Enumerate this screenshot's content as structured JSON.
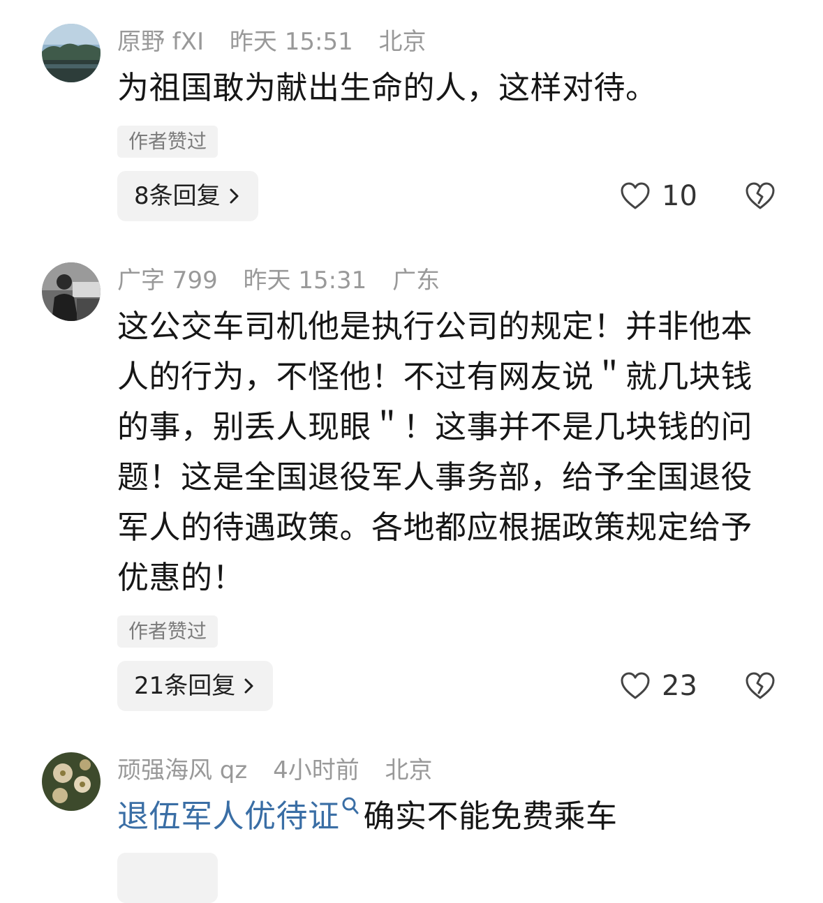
{
  "comments": [
    {
      "username": "原野 fXI",
      "time": "昨天 15:51",
      "location": "北京",
      "text": "为祖国敢为献出生命的人，这样对待。",
      "badge": "作者赞过",
      "replies_label": "8条回复",
      "likes": "10",
      "avatar_icon": "landscape-lake-avatar"
    },
    {
      "username": "广字 799",
      "time": "昨天 15:31",
      "location": "广东",
      "text": "这公交车司机他是执行公司的规定！并非他本人的行为，不怪他！不过有网友说＂就几块钱的事，别丢人现眼＂！这事并不是几块钱的问题！这是全国退役军人事务部，给予全国退役军人的待遇政策。各地都应根据政策规定给予优惠的！",
      "badge": "作者赞过",
      "replies_label": "21条回复",
      "likes": "23",
      "avatar_icon": "person-photo-avatar"
    },
    {
      "username": "顽强海风 qz",
      "time": "4小时前",
      "location": "北京",
      "link_text": "退伍军人优待证",
      "text": "确实不能免费乘车",
      "avatar_icon": "chrysanthemum-flower-avatar"
    }
  ],
  "colors": {
    "meta_gray": "#999999",
    "link_blue": "#3a6ea5",
    "badge_bg": "#f2f2f2"
  }
}
